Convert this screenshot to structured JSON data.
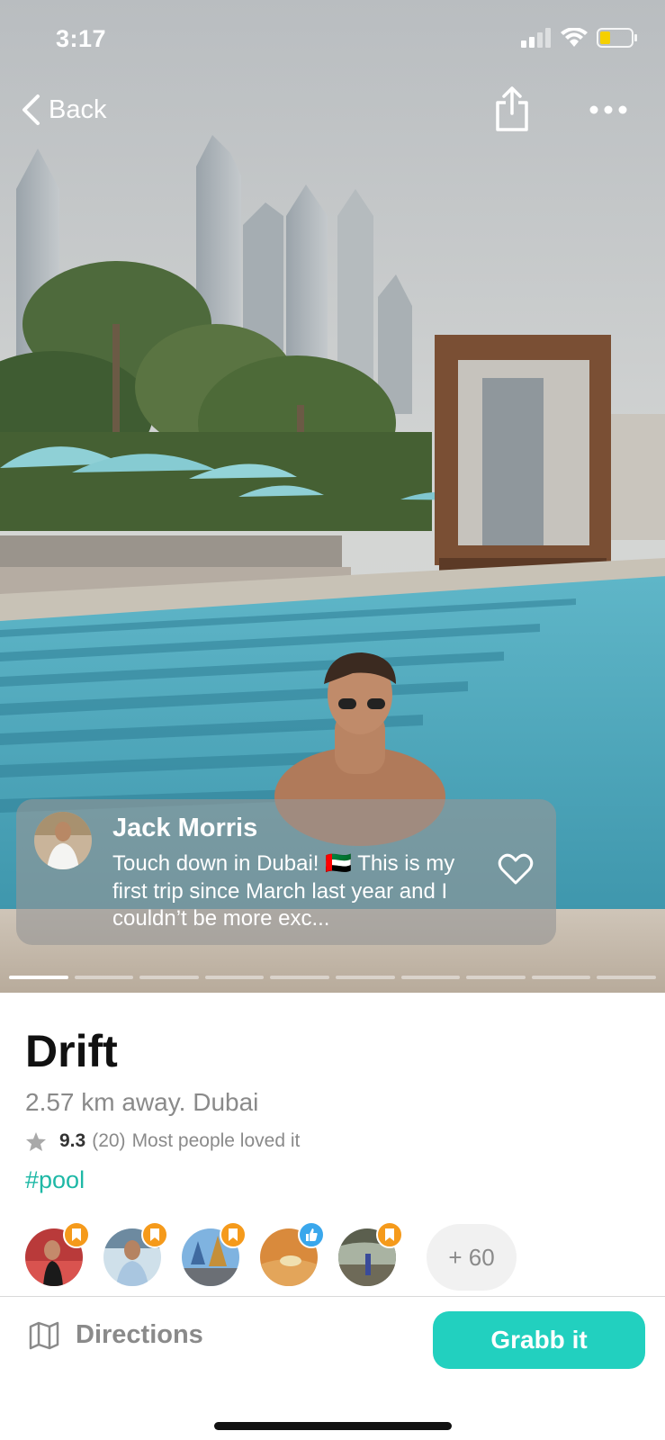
{
  "status": {
    "time": "3:17"
  },
  "nav": {
    "back_label": "Back"
  },
  "story": {
    "author": "Jack Morris",
    "text": "Touch down in Dubai! 🇦🇪 This is my first trip since March last year and I couldn’t be more exc...",
    "slide_count": 10,
    "active_slide": 1
  },
  "place": {
    "title": "Drift",
    "subtitle": "2.57 km away. Dubai",
    "rating": "9.3",
    "rating_count": "(20)",
    "rating_note": "Most people loved it",
    "hashtag": "#pool"
  },
  "friends": {
    "avatars": [
      {
        "badge": "bookmark-icon",
        "badge_color": "#f59a1b"
      },
      {
        "badge": "bookmark-icon",
        "badge_color": "#f59a1b"
      },
      {
        "badge": "bookmark-icon",
        "badge_color": "#f59a1b"
      },
      {
        "badge": "thumbs-up-icon",
        "badge_color": "#3aa7ec"
      },
      {
        "badge": "bookmark-icon",
        "badge_color": "#f59a1b"
      }
    ],
    "more_label": "+ 60"
  },
  "actions": {
    "directions_label": "Directions",
    "grab_label": "Grabb it"
  },
  "colors": {
    "accent": "#22d0bf",
    "hashtag": "#1eb8a6",
    "badge_orange": "#f59a1b",
    "badge_blue": "#3aa7ec"
  }
}
